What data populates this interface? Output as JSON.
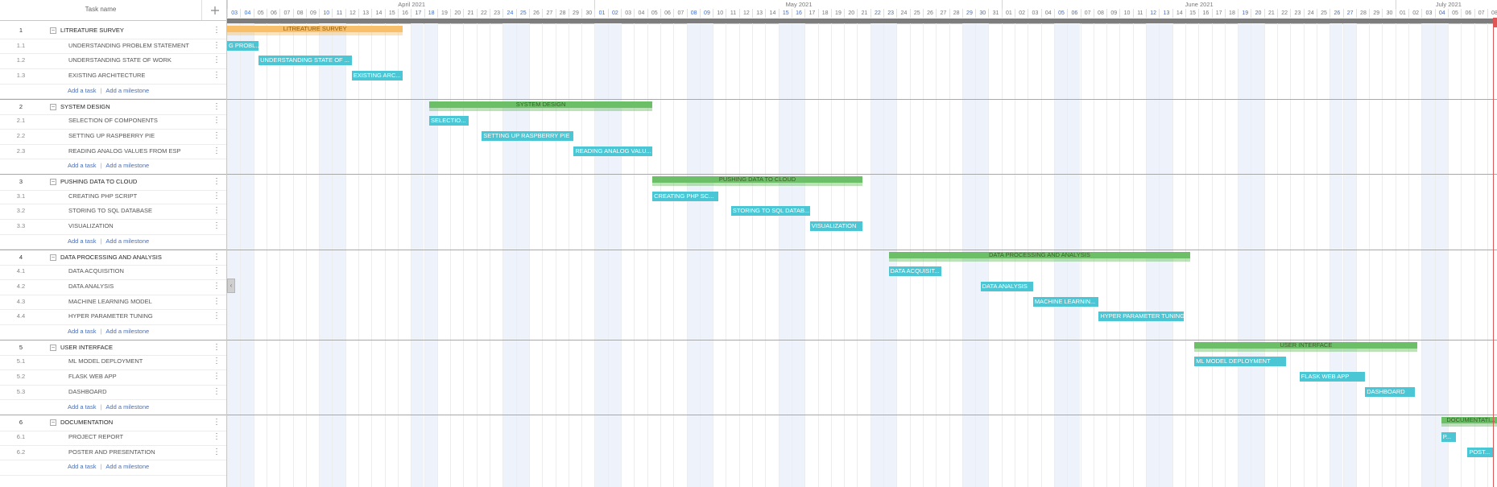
{
  "grid": {
    "header": "Task name"
  },
  "months": [
    "April 2021",
    "May 2021",
    "June 2021",
    "July 2021"
  ],
  "groups": [
    {
      "num": "1",
      "name": "LITREATURE SURVEY",
      "color": "#f8c06b",
      "tasks": [
        {
          "num": "1.1",
          "name": "UNDERSTANDING PROBLEM STATEMENT",
          "bar": "G PROBL..."
        },
        {
          "num": "1.2",
          "name": "UNDERSTANDING STATE OF WORK",
          "bar": "UNDERSTANDING STATE OF ..."
        },
        {
          "num": "1.3",
          "name": "EXISTING ARCHITECTURE",
          "bar": "EXISTING ARC..."
        }
      ]
    },
    {
      "num": "2",
      "name": "SYSTEM DESIGN",
      "color": "#6dbf67",
      "tasks": [
        {
          "num": "2.1",
          "name": "SELECTION OF COMPONENTS",
          "bar": "SELECTIO..."
        },
        {
          "num": "2.2",
          "name": "SETTING UP RASPBERRY PIE",
          "bar": "SETTING UP RASPBERRY PIE"
        },
        {
          "num": "2.3",
          "name": "READING ANALOG VALUES FROM ESP",
          "bar": "READING ANALOG VALU..."
        }
      ]
    },
    {
      "num": "3",
      "name": "PUSHING DATA TO CLOUD",
      "color": "#6dbf67",
      "tasks": [
        {
          "num": "3.1",
          "name": "CREATING PHP SCRIPT",
          "bar": "CREATING PHP SC..."
        },
        {
          "num": "3.2",
          "name": "STORING TO SQL DATABASE",
          "bar": "STORING TO SQL DATAB..."
        },
        {
          "num": "3.3",
          "name": "VISUALIZATION",
          "bar": "VISUALIZATION"
        }
      ]
    },
    {
      "num": "4",
      "name": "DATA PROCESSING AND ANALYSIS",
      "color": "#6dbf67",
      "tasks": [
        {
          "num": "4.1",
          "name": "DATA ACQUISITION",
          "bar": "DATA ACQUISIT..."
        },
        {
          "num": "4.2",
          "name": "DATA ANALYSIS",
          "bar": "DATA ANALYSIS"
        },
        {
          "num": "4.3",
          "name": "MACHINE LEARNING MODEL",
          "bar": "MACHINE LEARNIN..."
        },
        {
          "num": "4.4",
          "name": "HYPER PARAMETER TUNING",
          "bar": "HYPER PARAMETER TUNING"
        }
      ]
    },
    {
      "num": "5",
      "name": "USER INTERFACE",
      "color": "#6dbf67",
      "tasks": [
        {
          "num": "5.1",
          "name": "ML MODEL DEPLOYMENT",
          "bar": "ML MODEL DEPLOYMENT"
        },
        {
          "num": "5.2",
          "name": "FLASK WEB APP",
          "bar": "FLASK WEB APP"
        },
        {
          "num": "5.3",
          "name": "DASHBOARD",
          "bar": "DASHBOARD"
        }
      ]
    },
    {
      "num": "6",
      "name": "DOCUMENTATION",
      "color": "#6dbf67",
      "bar": "DOCUMENTATI...",
      "tasks": [
        {
          "num": "6.1",
          "name": "PROJECT REPORT",
          "bar": "P..."
        },
        {
          "num": "6.2",
          "name": "POSTER AND PRESENTATION",
          "bar": "POST..."
        }
      ]
    }
  ],
  "add_task": "Add a task",
  "add_milestone": "Add a milestone",
  "colors": {
    "task_bar": "#4bc6d4",
    "summary_bar": "#6dbf67",
    "first_summary_bar": "#f8c06b",
    "weekend_day": "#3b6fd1",
    "today_line": "#e05555"
  }
}
